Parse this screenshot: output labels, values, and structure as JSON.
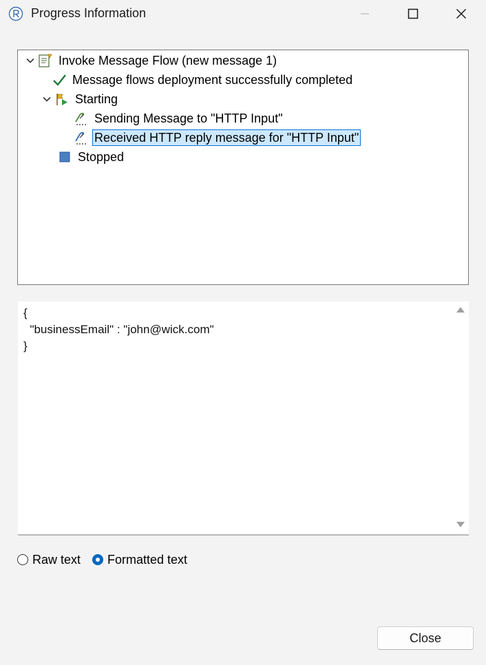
{
  "window": {
    "title": "Progress Information",
    "controls": [
      "minimize-icon",
      "maximize-icon",
      "close-icon"
    ]
  },
  "tree": {
    "items": [
      {
        "label": "Invoke Message Flow (new message 1)",
        "icon": "invoke-flow-icon",
        "expanded": true,
        "level": 0
      },
      {
        "label": "Message flows deployment successfully completed",
        "icon": "checkmark-icon",
        "level": 1
      },
      {
        "label": "Starting",
        "icon": "start-flag-icon",
        "expanded": true,
        "level": 1
      },
      {
        "label": "Sending Message to \"HTTP Input\"",
        "icon": "send-message-icon",
        "level": 2
      },
      {
        "label": "Received HTTP reply message for \"HTTP Input\"",
        "icon": "receive-message-icon",
        "level": 2,
        "selected": true
      },
      {
        "label": "Stopped",
        "icon": "stop-icon",
        "level": 1
      }
    ]
  },
  "message_body": "{\n  \"businessEmail\" : \"john@wick.com\"\n}",
  "view_mode": {
    "options": [
      {
        "label": "Raw text",
        "checked": false
      },
      {
        "label": "Formatted text",
        "checked": true
      }
    ]
  },
  "buttons": {
    "close_label": "Close"
  },
  "colors": {
    "selection_bg": "#cce8ff",
    "selection_border": "#0a74d6",
    "radio_accent": "#0067c0",
    "check_green": "#1f7a3a"
  }
}
